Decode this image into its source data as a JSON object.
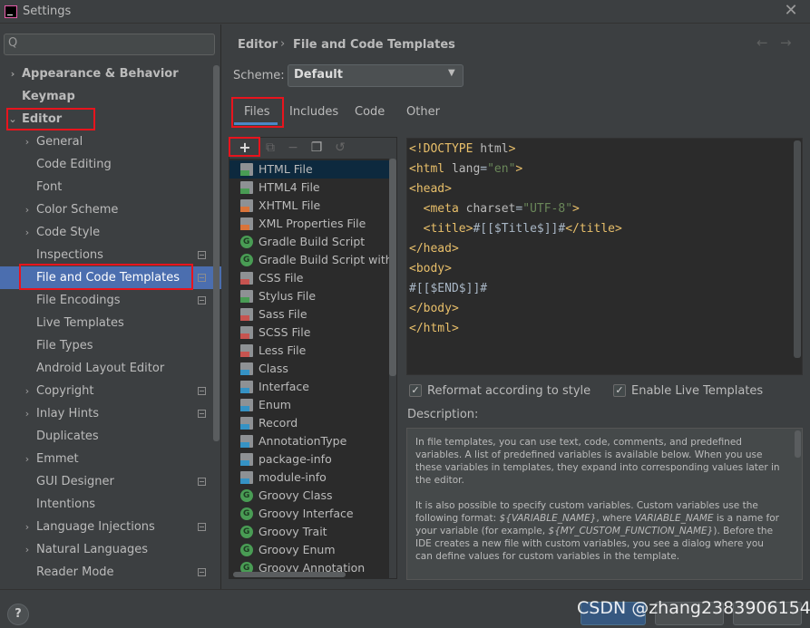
{
  "window": {
    "title": "Settings",
    "close": "✕"
  },
  "sidebar": {
    "search_icon": "Q",
    "items": [
      {
        "label": "Appearance & Behavior",
        "level": 0,
        "chevron": "›",
        "bold": true
      },
      {
        "label": "Keymap",
        "level": 0,
        "chevron": "",
        "bold": true
      },
      {
        "label": "Editor",
        "level": 0,
        "chevron": "⌄",
        "bold": true
      },
      {
        "label": "General",
        "level": 1,
        "chevron": "›"
      },
      {
        "label": "Code Editing",
        "level": 1,
        "chevron": ""
      },
      {
        "label": "Font",
        "level": 1,
        "chevron": ""
      },
      {
        "label": "Color Scheme",
        "level": 1,
        "chevron": "›"
      },
      {
        "label": "Code Style",
        "level": 1,
        "chevron": "›"
      },
      {
        "label": "Inspections",
        "level": 1,
        "chevron": "",
        "project": true
      },
      {
        "label": "File and Code Templates",
        "level": 1,
        "chevron": "",
        "project": true,
        "selected": true
      },
      {
        "label": "File Encodings",
        "level": 1,
        "chevron": "",
        "project": true
      },
      {
        "label": "Live Templates",
        "level": 1,
        "chevron": ""
      },
      {
        "label": "File Types",
        "level": 1,
        "chevron": ""
      },
      {
        "label": "Android Layout Editor",
        "level": 1,
        "chevron": ""
      },
      {
        "label": "Copyright",
        "level": 1,
        "chevron": "›",
        "project": true
      },
      {
        "label": "Inlay Hints",
        "level": 1,
        "chevron": "›",
        "project": true
      },
      {
        "label": "Duplicates",
        "level": 1,
        "chevron": ""
      },
      {
        "label": "Emmet",
        "level": 1,
        "chevron": "›"
      },
      {
        "label": "GUI Designer",
        "level": 1,
        "chevron": "",
        "project": true
      },
      {
        "label": "Intentions",
        "level": 1,
        "chevron": ""
      },
      {
        "label": "Language Injections",
        "level": 1,
        "chevron": "›",
        "project": true
      },
      {
        "label": "Natural Languages",
        "level": 1,
        "chevron": "›"
      },
      {
        "label": "Reader Mode",
        "level": 1,
        "chevron": "",
        "project": true
      }
    ]
  },
  "breadcrumb": {
    "parent": "Editor",
    "separator": "›",
    "page": "File and Code Templates",
    "back": "←",
    "forward": "→"
  },
  "scheme": {
    "label": "Scheme:",
    "value": "Default",
    "arrow": "▼"
  },
  "tabs": [
    {
      "label": "Files",
      "active": true
    },
    {
      "label": "Includes"
    },
    {
      "label": "Code"
    },
    {
      "label": "Other"
    }
  ],
  "toolbar": {
    "add": "+",
    "copy": "⧉",
    "remove": "−",
    "duplicate": "❐",
    "reset": "↺"
  },
  "files": [
    {
      "name": "HTML File",
      "icon": "doc",
      "color": "#499c54",
      "selected": true
    },
    {
      "name": "HTML4 File",
      "icon": "doc",
      "color": "#499c54"
    },
    {
      "name": "XHTML File",
      "icon": "doc",
      "color": "#d9743a"
    },
    {
      "name": "XML Properties File",
      "icon": "doc",
      "color": "#d9743a"
    },
    {
      "name": "Gradle Build Script",
      "icon": "circ"
    },
    {
      "name": "Gradle Build Script with wr",
      "icon": "circ"
    },
    {
      "name": "CSS File",
      "icon": "doc",
      "color": "#c75450"
    },
    {
      "name": "Stylus File",
      "icon": "doc",
      "color": "#499c54"
    },
    {
      "name": "Sass File",
      "icon": "doc",
      "color": "#c75450"
    },
    {
      "name": "SCSS File",
      "icon": "doc",
      "color": "#c75450"
    },
    {
      "name": "Less File",
      "icon": "doc",
      "color": "#c75450"
    },
    {
      "name": "Class",
      "icon": "doc",
      "color": "#3592c4"
    },
    {
      "name": "Interface",
      "icon": "doc",
      "color": "#3592c4"
    },
    {
      "name": "Enum",
      "icon": "doc",
      "color": "#3592c4"
    },
    {
      "name": "Record",
      "icon": "doc",
      "color": "#3592c4"
    },
    {
      "name": "AnnotationType",
      "icon": "doc",
      "color": "#3592c4"
    },
    {
      "name": "package-info",
      "icon": "doc",
      "color": "#3592c4"
    },
    {
      "name": "module-info",
      "icon": "doc",
      "color": "#3592c4"
    },
    {
      "name": "Groovy Class",
      "icon": "circ"
    },
    {
      "name": "Groovy Interface",
      "icon": "circ"
    },
    {
      "name": "Groovy Trait",
      "icon": "circ"
    },
    {
      "name": "Groovy Enum",
      "icon": "circ"
    },
    {
      "name": "Groovy Annotation",
      "icon": "circ"
    }
  ],
  "code": [
    [
      {
        "t": "<!DOCTYPE ",
        "c": "tag"
      },
      {
        "t": "html",
        "c": "attr"
      },
      {
        "t": ">",
        "c": "tag"
      }
    ],
    [
      {
        "t": "<html ",
        "c": "tag"
      },
      {
        "t": "lang",
        "c": "attr"
      },
      {
        "t": "=",
        "c": "txt"
      },
      {
        "t": "\"en\"",
        "c": "val"
      },
      {
        "t": ">",
        "c": "tag"
      }
    ],
    [
      {
        "t": "<head>",
        "c": "tag"
      }
    ],
    [
      {
        "t": "  <meta ",
        "c": "tag"
      },
      {
        "t": "charset",
        "c": "attr"
      },
      {
        "t": "=",
        "c": "txt"
      },
      {
        "t": "\"UTF-8\"",
        "c": "val"
      },
      {
        "t": ">",
        "c": "tag"
      }
    ],
    [
      {
        "t": "  <title>",
        "c": "tag"
      },
      {
        "t": "#[[$Title$]]#",
        "c": "txt"
      },
      {
        "t": "</title>",
        "c": "tag"
      }
    ],
    [
      {
        "t": "</head>",
        "c": "tag"
      }
    ],
    [
      {
        "t": "<body>",
        "c": "tag"
      }
    ],
    [
      {
        "t": "#[[$END$]]#",
        "c": "txt"
      }
    ],
    [
      {
        "t": "</body>",
        "c": "tag"
      }
    ],
    [
      {
        "t": "</html>",
        "c": "tag"
      }
    ]
  ],
  "options": {
    "reformat": {
      "label": "Reformat according to style",
      "checked": true
    },
    "live_templates": {
      "label": "Enable Live Templates",
      "checked": true
    }
  },
  "description": {
    "label": "Description:",
    "p1": "In file templates, you can use text, code, comments, and predefined variables. A list of predefined variables is available below. When you use these variables in templates, they expand into corresponding values later in the editor.",
    "p2_a": "It is also possible to specify custom variables. Custom variables use the following format: ",
    "p2_var": "${VARIABLE_NAME}",
    "p2_b": ", where ",
    "p2_var2": "VARIABLE_NAME",
    "p2_c": " is a name for your variable (for example, ",
    "p2_var3": "${MY_CUSTOM_FUNCTION_NAME}",
    "p2_d": "). Before the IDE creates a new file with custom variables, you see a dialog where you can define values for custom variables in the template."
  },
  "bottom": {
    "help": "?",
    "watermark": "CSDN @zhang2383906154"
  },
  "colors": {
    "selection": "#4b6eaf",
    "highlight": "#e8141d",
    "tab_underline": "#4a88c7"
  }
}
